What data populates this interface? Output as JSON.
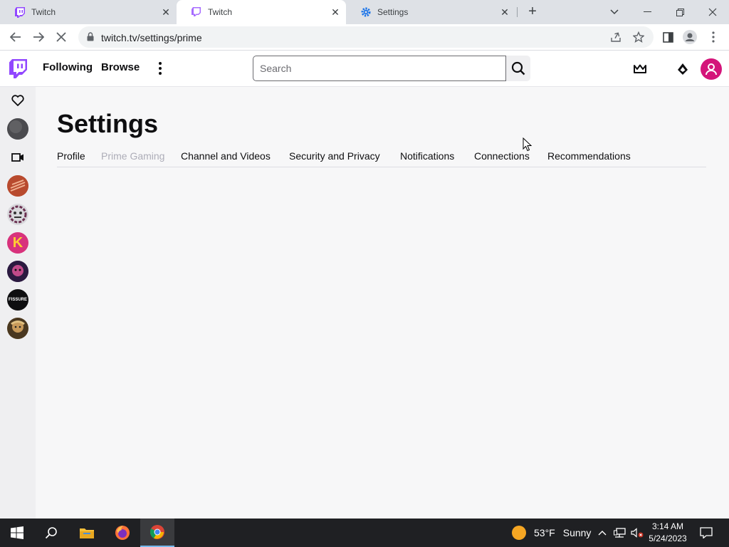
{
  "browser": {
    "tabs": [
      {
        "title": "Twitch",
        "active": false
      },
      {
        "title": "Twitch",
        "active": true
      },
      {
        "title": "Settings",
        "active": false
      }
    ],
    "url": "twitch.tv/settings/prime"
  },
  "twitch_nav": {
    "following": "Following",
    "browse": "Browse",
    "search_placeholder": "Search",
    "brand_color": "#9147ff",
    "avatar_color": "#d4147a"
  },
  "settings": {
    "title": "Settings",
    "tabs": [
      {
        "label": "Profile",
        "active": false
      },
      {
        "label": "Prime Gaming",
        "active": true
      },
      {
        "label": "Channel and Videos",
        "active": false
      },
      {
        "label": "Security and Privacy",
        "active": false
      },
      {
        "label": "Notifications",
        "active": false
      },
      {
        "label": "Connections",
        "active": false
      },
      {
        "label": "Recommendations",
        "active": false
      }
    ]
  },
  "sidebar": {
    "channel_initials": [
      "K",
      "FISSURE"
    ]
  },
  "taskbar": {
    "temperature": "53°F",
    "condition": "Sunny",
    "time": "3:14 AM",
    "date": "5/24/2023"
  }
}
